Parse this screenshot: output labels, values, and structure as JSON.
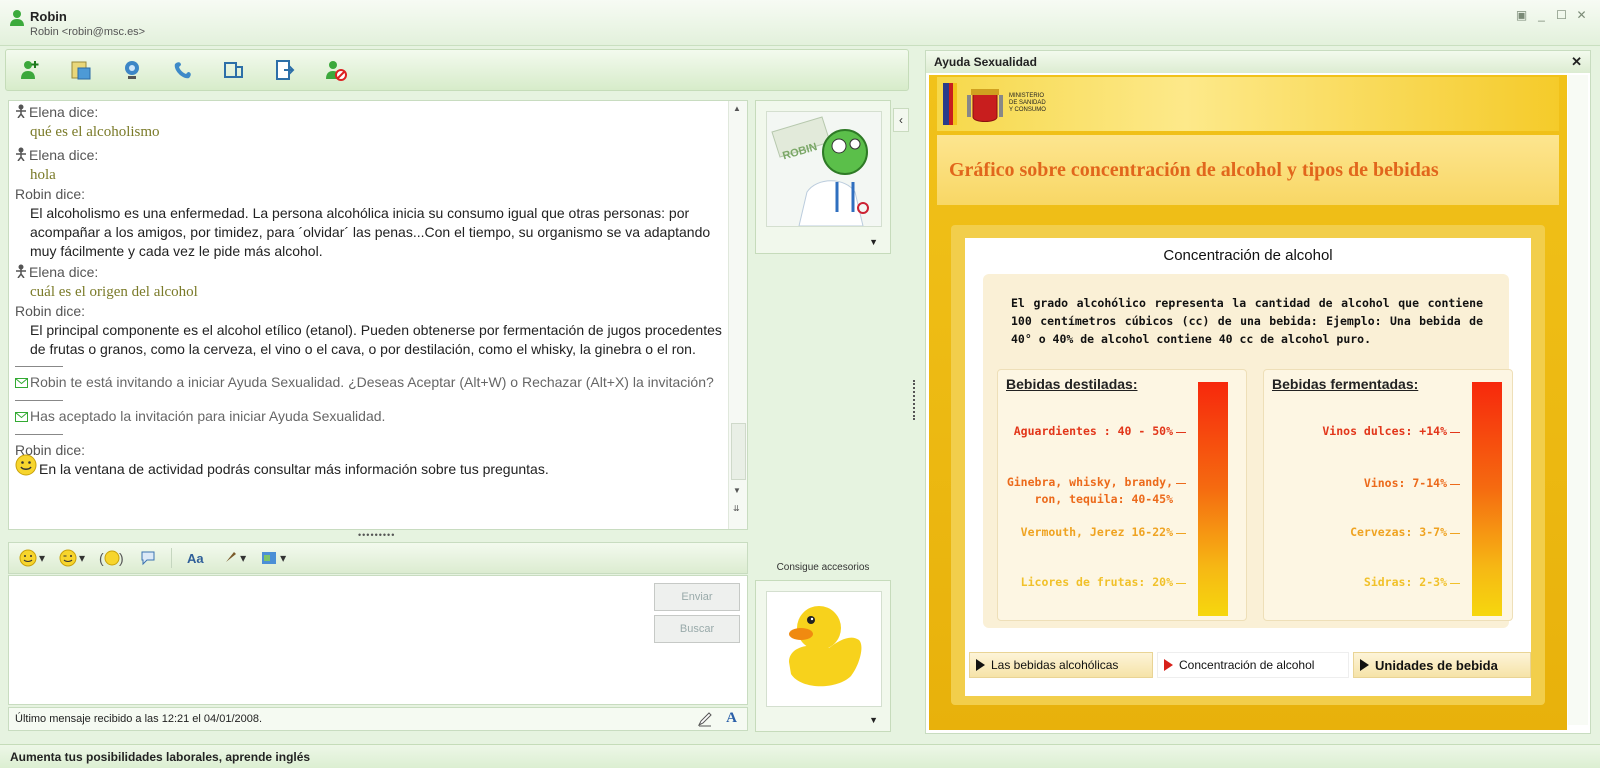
{
  "window": {
    "contact_name": "Robin",
    "contact_email": "Robin <robin@msc.es>"
  },
  "toolbar": {
    "icons": [
      "invite-contact-icon",
      "send-files-icon",
      "webcam-icon",
      "call-icon",
      "activities-icon",
      "games-icon",
      "block-contact-icon"
    ]
  },
  "conversation": {
    "messages": [
      {
        "sender": "Elena dice:",
        "text": "qué es el alcoholismo"
      },
      {
        "sender": "Elena dice:",
        "text": "hola"
      },
      {
        "sender": "Robin dice:",
        "text": "El alcoholismo es una enfermedad. La persona alcohólica inicia su consumo igual que otras personas: por acompañar a los amigos, por timidez, para ´olvidar´ las penas...Con el tiempo, su organismo se va adaptando muy fácilmente y cada vez le pide más alcohol."
      },
      {
        "sender": "Elena dice:",
        "text": "cuál es el origen del alcohol"
      },
      {
        "sender": "Robin dice:",
        "text": "El principal componente es el alcohol etílico (etanol). Pueden obtenerse por fermentación de jugos procedentes de frutas o granos, como la cerveza, el vino o el cava, o por destilación, como el whisky, la ginebra o el ron."
      },
      {
        "system": "Robin te está invitando a iniciar Ayuda Sexualidad. ¿Deseas Aceptar (Alt+W) o Rechazar (Alt+X) la invitación?"
      },
      {
        "system": "Has aceptado la invitación para iniciar Ayuda Sexualidad."
      },
      {
        "sender": "Robin dice:",
        "text": "En la ventana de actividad podrás consultar más información sobre tus preguntas."
      }
    ]
  },
  "compose": {
    "send_label": "Enviar",
    "search_label": "Buscar",
    "status": "Último mensaje recibido a las 12:21 el 04/01/2008."
  },
  "side": {
    "accessories_label": "Consigue accesorios",
    "avatar_text": "ROBIN"
  },
  "activity": {
    "panel_title": "Ayuda Sexualidad",
    "ministry_lines": [
      "MINISTERIO",
      "DE SANIDAD",
      "Y CONSUMO"
    ],
    "heading": "Gráfico sobre concentración de alcohol y tipos de bebidas",
    "card_title": "Concentración de alcohol",
    "intro": "El grado alcohólico representa la cantidad de alcohol que contiene 100 centímetros cúbicos (cc) de una bebida: Ejemplo: Una bebida de 40° o 40% de alcohol contiene 40 cc de alcohol puro.",
    "distilled": {
      "title": "Bebidas destiladas:",
      "items": [
        "Aguardientes : 40 - 50%",
        "Ginebra, whisky, brandy,",
        "ron, tequila: 40-45%",
        "Vermouth, Jerez 16-22%",
        "Licores de frutas: 20%"
      ]
    },
    "fermented": {
      "title": "Bebidas fermentadas:",
      "items": [
        "Vinos dulces: +14%",
        "Vinos: 7-14%",
        "Cervezas: 3-7%",
        "Sidras: 2-3%"
      ]
    },
    "nav": [
      "Las bebidas alcohólicas",
      "Concentración de alcohol",
      "Unidades de bebida"
    ],
    "colors": {
      "high": "#e2361a",
      "mid": "#ec6a1b",
      "low": "#efa321",
      "lowest": "#f1c12a"
    }
  },
  "footer": {
    "ad": "Aumenta tus posibilidades laborales, aprende inglés"
  }
}
